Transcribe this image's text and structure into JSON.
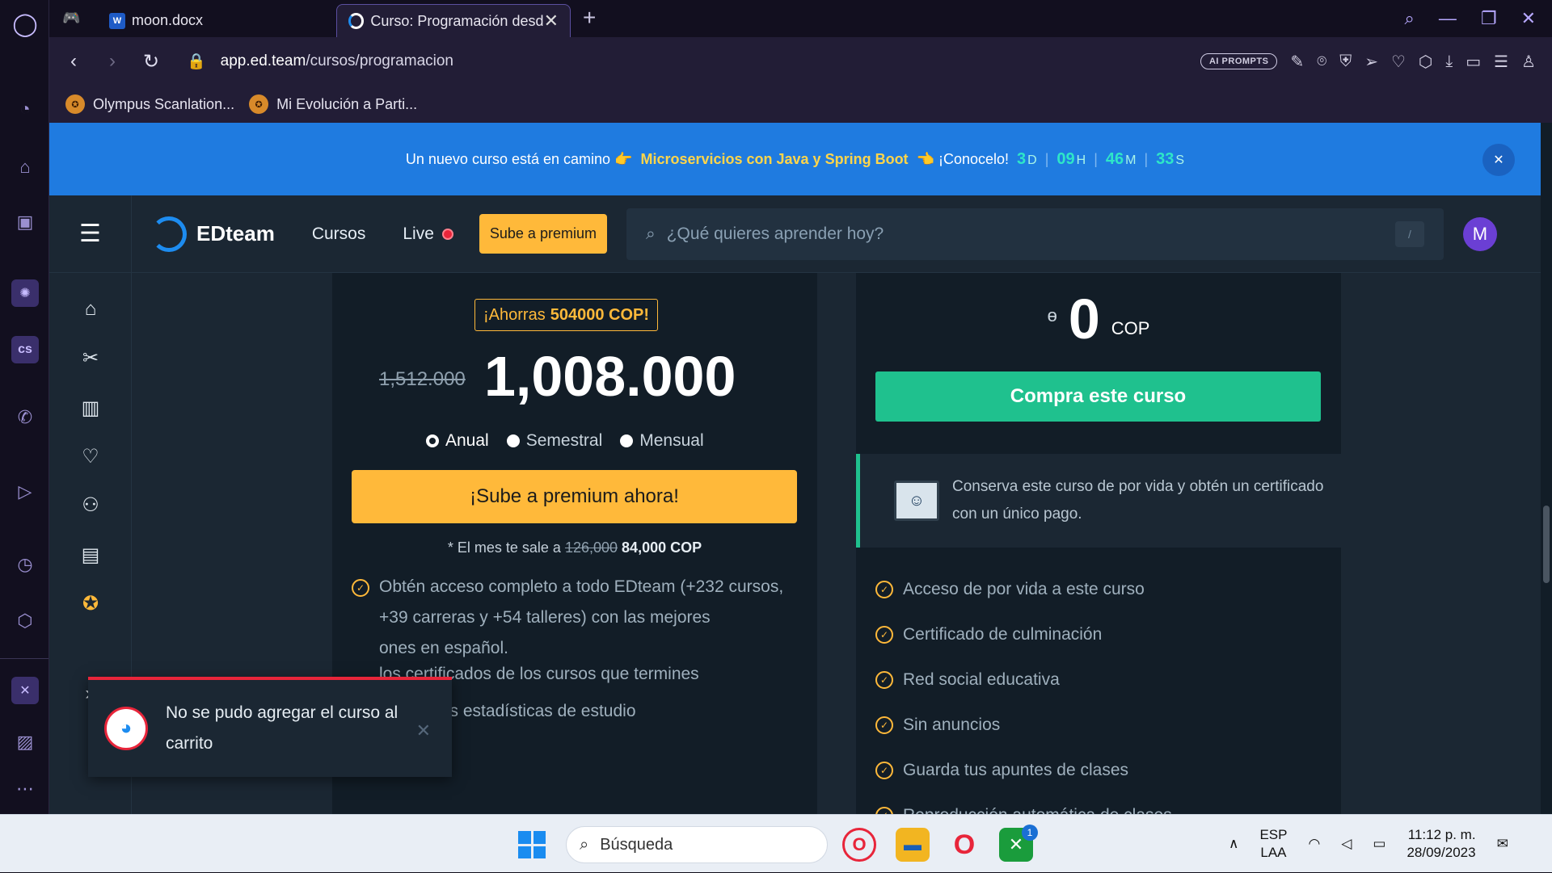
{
  "browser": {
    "tabs": [
      {
        "title": "moon.docx",
        "active": false
      },
      {
        "title": "Curso: Programación desde",
        "active": true
      }
    ],
    "url": {
      "host": "app.ed.team",
      "path": "/cursos/programacion"
    },
    "ai_prompts": "AI PROMPTS",
    "bookmarks": [
      {
        "label": "Olympus Scanlation..."
      },
      {
        "label": "Mi Evolución a Parti..."
      }
    ]
  },
  "promo": {
    "text": "Un nuevo curso está en camino 👉",
    "link": "Microservicios con Java y Spring Boot",
    "cta": "👈 ¡Conocelo!",
    "countdown": {
      "days": "3",
      "days_unit": "D",
      "hours": "09",
      "hours_unit": "H",
      "minutes": "46",
      "minutes_unit": "M",
      "seconds": "33",
      "seconds_unit": "S"
    },
    "close": "✕"
  },
  "nav": {
    "brand": "EDteam",
    "cursos": "Cursos",
    "live": "Live",
    "premium": "Sube a premium",
    "search_placeholder": "¿Qué quieres aprender hoy?",
    "search_shortcut": "/",
    "avatar": "M"
  },
  "plan": {
    "savings_prefix": "¡Ahorras",
    "savings_amount": "504000 COP!",
    "old_price": "1,512.000",
    "new_price": "1,008.000",
    "periods": [
      {
        "label": "Anual",
        "selected": true
      },
      {
        "label": "Semestral",
        "selected": false
      },
      {
        "label": "Mensual",
        "selected": false
      }
    ],
    "cta": "¡Sube a premium ahora!",
    "monthly_prefix": "* El mes te sale a",
    "monthly_old": "126,000",
    "monthly_new": "84,000 COP",
    "benefits": [
      "Obtén acceso completo a todo EDteam (+232 cursos, +39 carreras y +54 talleres) con las mejores",
      "ones en español.",
      "los certificados de los cursos que termines",
      "Revisa tus estadísticas de estudio"
    ]
  },
  "buy": {
    "currency_symbol": "ɵ",
    "price": "0",
    "unit": "COP",
    "cta": "Compra este curso",
    "note": "Conserva este curso de por vida y obtén un certificado con un único pago.",
    "features": [
      "Acceso de por vida a este curso",
      "Certificado de culminación",
      "Red social educativa",
      "Sin anuncios",
      "Guarda tus apuntes de clases",
      "Reproducción automática de clases"
    ]
  },
  "toast": {
    "message": "No se pudo agregar el curso al carrito",
    "close": "✕"
  },
  "taskbar": {
    "search": "Búsqueda",
    "lang_top": "ESP",
    "lang_bottom": "LAA",
    "time": "11:12 p. m.",
    "date": "28/09/2023",
    "badge": "1"
  }
}
